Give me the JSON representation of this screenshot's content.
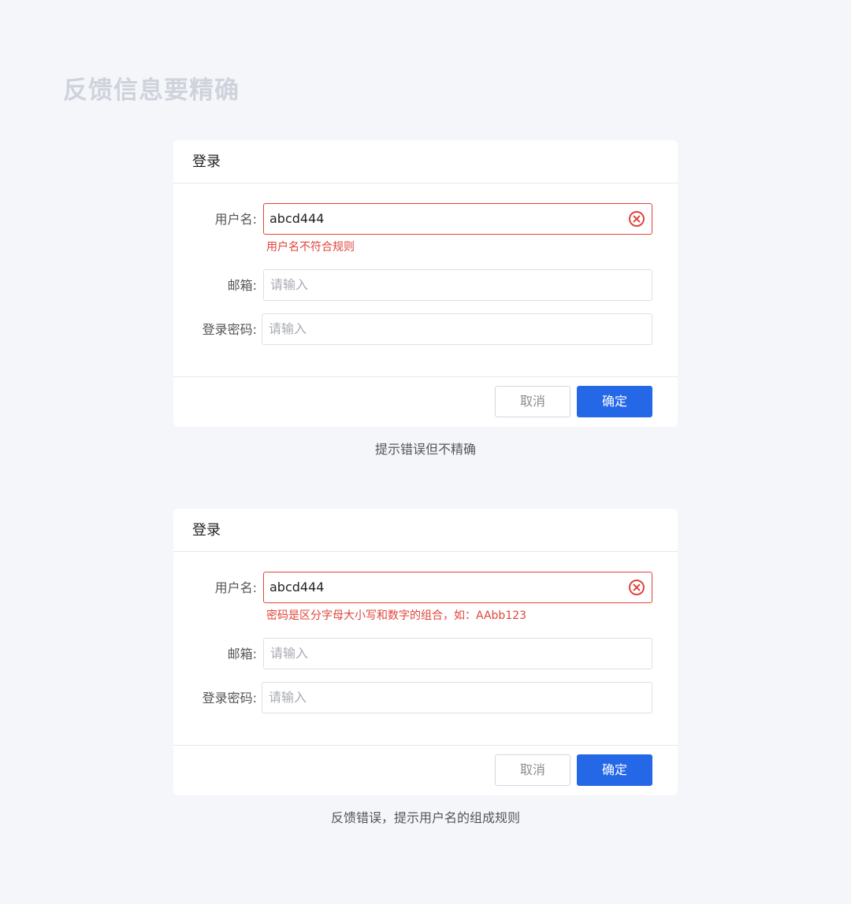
{
  "page": {
    "title": "反馈信息要精确"
  },
  "examples": [
    {
      "card_title": "登录",
      "username_label": "用户名:",
      "username_value": "abcd444",
      "username_error": "用户名不符合规则",
      "email_label": "邮箱:",
      "email_placeholder": "请输入",
      "password_label": "登录密码:",
      "password_placeholder": "请输入",
      "cancel_label": "取消",
      "confirm_label": "确定",
      "caption": "提示错误但不精确"
    },
    {
      "card_title": "登录",
      "username_label": "用户名:",
      "username_value": "abcd444",
      "username_error": "密码是区分字母大小写和数字的组合，如：AAbb123",
      "email_label": "邮箱:",
      "email_placeholder": "请输入",
      "password_label": "登录密码:",
      "password_placeholder": "请输入",
      "cancel_label": "取消",
      "confirm_label": "确定",
      "caption": "反馈错误，提示用户名的组成规则"
    }
  ],
  "colors": {
    "background": "#f5f6fa",
    "error": "#e0443a",
    "primary": "#2468e8",
    "title": "#cfd3dc"
  },
  "icons": {
    "clear": "close-circle-icon"
  }
}
